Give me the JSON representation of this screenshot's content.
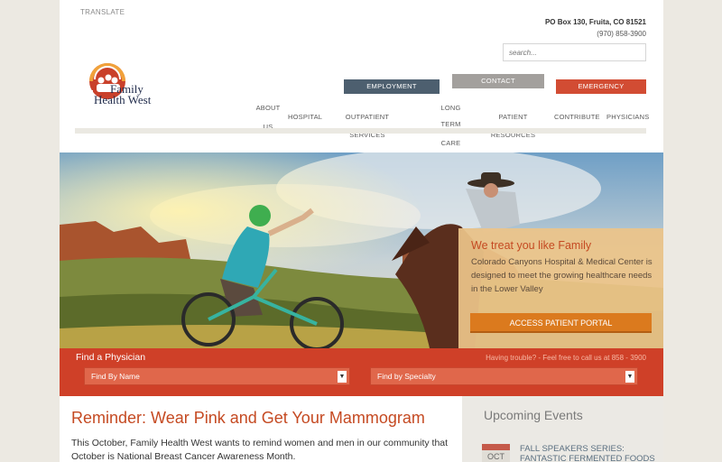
{
  "header": {
    "translate": "TRANSLATE",
    "address": "PO Box 130, Fruita, CO 81521",
    "phone": "(970) 858-3900",
    "search_placeholder": "search...",
    "logo_line1": "Family",
    "logo_line2": "Health West"
  },
  "buttons": {
    "employment": "EMPLOYMENT",
    "contact": "CONTACT",
    "emergency": "EMERGENCY"
  },
  "nav": {
    "about_1": "ABOUT",
    "about_2": "US",
    "hospital": "HOSPITAL",
    "outpatient": "OUTPATIENT SERVICES",
    "longterm_1": "LONG TERM",
    "longterm_2": "CARE",
    "patient": "PATIENT RESOURCES",
    "contribute": "CONTRIBUTE",
    "physicians": "PHYSICIANS"
  },
  "hero": {
    "title": "We treat you like Family",
    "text": "Colorado Canyons Hospital & Medical Center is designed to meet the growing healthcare needs in the Lower Valley",
    "portal": "ACCESS PATIENT PORTAL"
  },
  "finder": {
    "title": "Find a Physician",
    "help": "Having trouble? - Feel free to call us at 858 - 3900",
    "by_name": "Find By Name",
    "by_specialty": "Find by Specialty"
  },
  "main": {
    "heading": "Reminder: Wear Pink and Get Your Mammogram",
    "paragraph": "This October, Family Health West wants to remind women and men in our community that October is National Breast Cancer Awareness Month."
  },
  "sidebar": {
    "heading": "Upcoming Events",
    "month": "OCT",
    "event_line1": "FALL SPEAKERS SERIES:",
    "event_line2": "FANTASTIC FERMENTED FOODS"
  },
  "colors": {
    "accent_red": "#cf4028",
    "title_orange": "#c54a22",
    "portal_orange": "#db7a1e",
    "employment_slate": "#4d5f6f"
  }
}
